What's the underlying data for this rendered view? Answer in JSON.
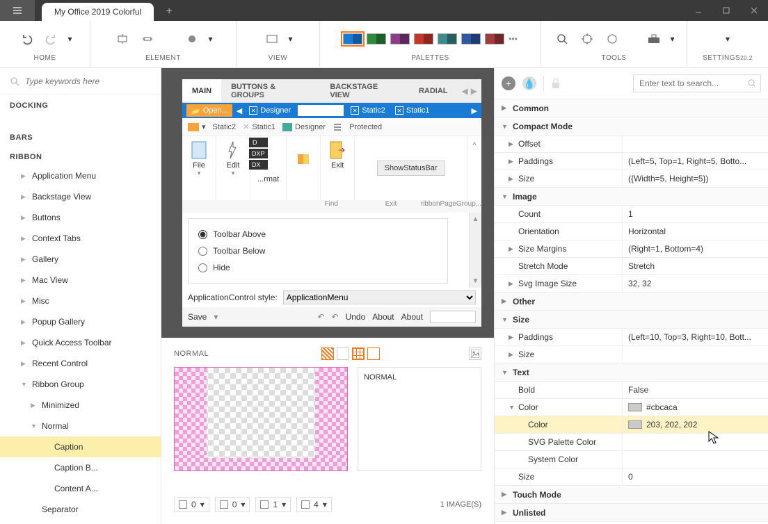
{
  "title": "My Office 2019 Colorful",
  "toolbar_groups": {
    "home": "HOME",
    "element": "ELEMENT",
    "view": "VIEW",
    "palettes": "PALETTES",
    "tools": "TOOLS",
    "settings": "SETTINGS",
    "settings_ver": "20.2"
  },
  "palette_colors": [
    [
      "#1a7bd4",
      "#0d5aa0"
    ],
    [
      "#2e8b3d",
      "#1d5e28"
    ],
    [
      "#8b3d8b",
      "#5e285e"
    ],
    [
      "#c0392b",
      "#8b2920"
    ],
    [
      "#3d8b8b",
      "#285e5e"
    ],
    [
      "#2c5aa0",
      "#1d3d6e"
    ],
    [
      "#a03d3d",
      "#6e2828"
    ]
  ],
  "sidebar": {
    "search_placeholder": "Type keywords here",
    "docking": "DOCKING",
    "bars": "BARS",
    "ribbon": "RIBBON",
    "items": [
      "Application Menu",
      "Backstage View",
      "Buttons",
      "Context Tabs",
      "Gallery",
      "Mac View",
      "Misc",
      "Popup Gallery",
      "Quick Access Toolbar",
      "Recent Control",
      "Ribbon Group"
    ],
    "ribbon_group_children": [
      "Minimized",
      "Normal"
    ],
    "normal_children": [
      "Caption",
      "Caption B...",
      "Content A..."
    ],
    "separator": "Separator"
  },
  "center": {
    "tabs": [
      "MAIN",
      "BUTTONS & GROUPS",
      "BACKSTAGE VIEW",
      "RADIAL"
    ],
    "open_label": "Open...",
    "designer": "Designer",
    "static2": "Static2",
    "static1": "Static1",
    "protected": "Protected",
    "groups": {
      "file": "File",
      "edit": "Edit",
      "format_badges": [
        "D",
        "DXP",
        "DX"
      ],
      "format_label": "...rmat",
      "exit": "Exit",
      "show_status": "ShowStatusBar"
    },
    "footer_groups": [
      "",
      "",
      "Find",
      "Exit",
      "ribbonPageGroup..."
    ],
    "options": [
      "Toolbar Above",
      "Toolbar Below",
      "Hide"
    ],
    "style_label": "ApplicationControl style:",
    "style_value": "ApplicationMenu",
    "save": "Save",
    "undo": "Undo",
    "about": "About"
  },
  "normal": {
    "label": "NORMAL",
    "box_label": "NORMAL",
    "margins": [
      0,
      0,
      1,
      4
    ],
    "count_label": "1 IMAGE(S)"
  },
  "props": {
    "search_placeholder": "Enter text to search...",
    "cats": {
      "common": "Common",
      "compact": "Compact Mode",
      "image": "Image",
      "other": "Other",
      "size": "Size",
      "text": "Text",
      "touch": "Touch Mode",
      "unlisted": "Unlisted"
    },
    "compact": {
      "offset": {
        "k": "Offset",
        "v": ""
      },
      "paddings": {
        "k": "Paddings",
        "v": "(Left=5, Top=1, Right=5, Botto..."
      },
      "size": {
        "k": "Size",
        "v": "({Width=5, Height=5})"
      }
    },
    "image": {
      "count": {
        "k": "Count",
        "v": "1"
      },
      "orientation": {
        "k": "Orientation",
        "v": "Horizontal"
      },
      "size_margins": {
        "k": "Size Margins",
        "v": "(Right=1, Bottom=4)"
      },
      "stretch": {
        "k": "Stretch Mode",
        "v": "Stretch"
      },
      "svg_size": {
        "k": "Svg Image Size",
        "v": "32, 32"
      }
    },
    "size": {
      "paddings": {
        "k": "Paddings",
        "v": "(Left=10, Top=3, Right=10, Bott..."
      },
      "size": {
        "k": "Size",
        "v": ""
      }
    },
    "text": {
      "bold": {
        "k": "Bold",
        "v": "False"
      },
      "color": {
        "k": "Color",
        "v": "#cbcaca"
      },
      "color_rgb": {
        "k": "Color",
        "v": "203, 202, 202"
      },
      "svg_palette": {
        "k": "SVG Palette Color",
        "v": ""
      },
      "system_color": {
        "k": "System Color",
        "v": ""
      },
      "size": {
        "k": "Size",
        "v": "0"
      }
    }
  }
}
